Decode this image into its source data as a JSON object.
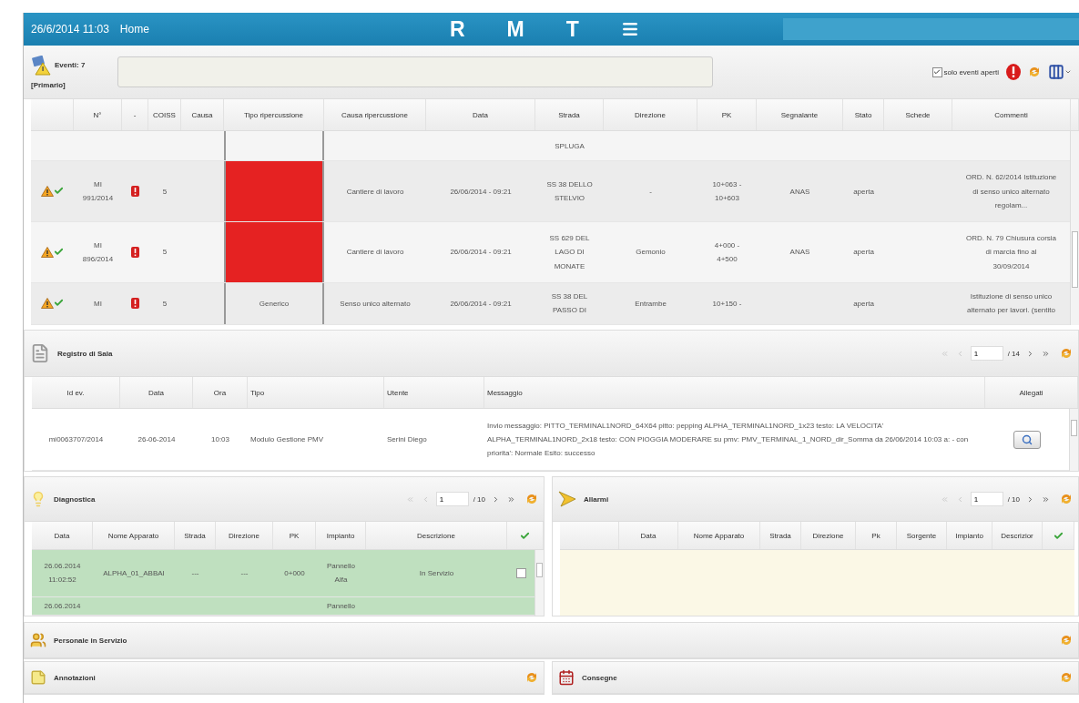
{
  "header": {
    "datetime": "26/6/2014 11:03",
    "home": "Home",
    "letters": [
      "R",
      "M",
      "T"
    ]
  },
  "events": {
    "title": "Eventi: 7",
    "subtitle": "[Primario]",
    "only_open": {
      "label": "solo eventi aperti",
      "checked": true
    },
    "columns": [
      "N°",
      "-",
      "COISS",
      "Causa",
      "Tipo ripercussione",
      "Causa ripercussione",
      "Data",
      "Strada",
      "Direzione",
      "PK",
      "Segnalante",
      "Stato",
      "Schede",
      "Commenti"
    ],
    "rows": [
      {
        "status_icons": false,
        "alert_icon": false,
        "tipo_alert": false,
        "strada": "SPLUGA"
      },
      {
        "status_icons": true,
        "alert_icon": true,
        "tipo_alert": true,
        "number": "MI\n991/2014",
        "coiss": "5",
        "causa_rip": "Cantiere di lavoro",
        "data": "26/06/2014 - 09:21",
        "strada": "SS 38 DELLO\nSTELVIO",
        "direzione": "-",
        "pk": "10+063 -\n10+603",
        "segnalante": "ANAS",
        "stato": "aperta",
        "commenti": "ORD. N. 62/2014 Istituzione\ndi senso unico alternato\nregolam..."
      },
      {
        "status_icons": true,
        "alert_icon": true,
        "tipo_alert": true,
        "number": "MI\n896/2014",
        "coiss": "5",
        "causa_rip": "Cantiere di lavoro",
        "data": "26/06/2014 - 09:21",
        "strada": "SS 629 DEL\nLAGO DI\nMONATE",
        "direzione": "Gemonio",
        "pk": "4+000 -\n4+500",
        "segnalante": "ANAS",
        "stato": "aperta",
        "commenti": "ORD. N. 79 Chiusura corsia\ndi marcia fino al\n30/09/2014"
      },
      {
        "status_icons": true,
        "alert_icon": true,
        "tipo_alert": false,
        "number": "MI",
        "coiss": "5",
        "tipo": "Generico",
        "causa_rip": "Senso unico alternato",
        "data": "26/06/2014 - 09:21",
        "strada": "SS 38 DEL\nPASSO DI",
        "direzione": "Entrambe",
        "pk": "10+150 -",
        "stato": "aperta",
        "commenti": "Istituzione di senso unico\nalternato per lavori. (sentito"
      }
    ]
  },
  "registro": {
    "title": "Registro di Sala",
    "pager": {
      "page": "1",
      "total": "/ 14"
    },
    "columns": [
      "Id ev.",
      "Data",
      "Ora",
      "Tipo",
      "Utente",
      "Messaggio",
      "Allegati"
    ],
    "rows": [
      {
        "cells": [
          "mi0063707/2014",
          "26-06-2014",
          "10:03",
          "Modulo Gestione PMV",
          "Serini Diego",
          "Invio messaggio: PITTO_TERMINAL1NORD_64X64 pitto: pepping ALPHA_TERMINAL1NORD_1x23 testo: LA VELOCITA' ALPHA_TERMINAL1NORD_2x18 testo: CON PIOGGIA MODERARE su pmv: PMV_TERMINAL_1_NORD_dir_Somma da 26/06/2014 10:03 a: - con priorita': Normale Esito: successo"
        ]
      }
    ]
  },
  "diagnostica": {
    "title": "Diagnostica",
    "pager": {
      "page": "1",
      "total": "/ 10"
    },
    "columns": [
      "Data",
      "Nome Apparato",
      "Strada",
      "Direzione",
      "PK",
      "Impianto",
      "Descrizione"
    ],
    "rows": [
      {
        "cells": [
          "26.06.2014\n11:02:52",
          "ALPHA_01_ABBAI",
          "---",
          "---",
          "0+000",
          "Pannello\nAlfa",
          "In Servizio"
        ],
        "checked": false
      },
      {
        "cells": [
          "26.06.2014",
          "",
          "",
          "",
          "",
          "Pannello",
          ""
        ]
      }
    ]
  },
  "allarmi": {
    "title": "Allarmi",
    "pager": {
      "page": "1",
      "total": "/ 10"
    },
    "columns": [
      "Data",
      "Nome Apparato",
      "Strada",
      "Direzione",
      "Pk",
      "Sorgente",
      "Impianto",
      "Descrizior"
    ]
  },
  "personale": {
    "title": "Personale in Servizio"
  },
  "annotazioni": {
    "title": "Annotazioni"
  },
  "consegne": {
    "title": "Consegne"
  }
}
